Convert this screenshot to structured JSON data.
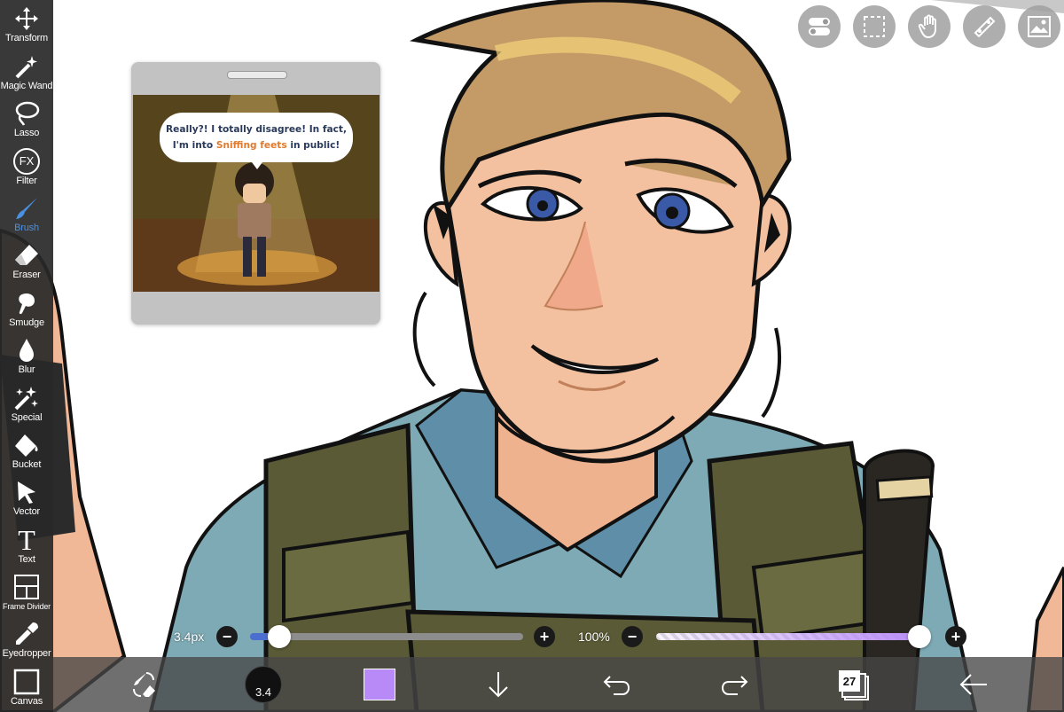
{
  "toolbar": {
    "items": [
      {
        "label": "Transform",
        "icon": "move-arrows-icon"
      },
      {
        "label": "Magic Wand",
        "icon": "magic-wand-icon"
      },
      {
        "label": "Lasso",
        "icon": "lasso-icon"
      },
      {
        "label": "Filter",
        "icon": "fx-icon"
      },
      {
        "label": "Brush",
        "icon": "brush-icon",
        "active": true
      },
      {
        "label": "Eraser",
        "icon": "eraser-icon"
      },
      {
        "label": "Smudge",
        "icon": "smudge-icon"
      },
      {
        "label": "Blur",
        "icon": "droplet-icon"
      },
      {
        "label": "Special",
        "icon": "sparkle-wand-icon"
      },
      {
        "label": "Bucket",
        "icon": "bucket-icon"
      },
      {
        "label": "Vector",
        "icon": "cursor-arrow-icon"
      },
      {
        "label": "Text",
        "icon": "text-t-icon"
      },
      {
        "label": "Frame Divider",
        "icon": "frame-divider-icon"
      },
      {
        "label": "Eyedropper",
        "icon": "eyedropper-icon"
      },
      {
        "label": "Canvas",
        "icon": "canvas-square-icon"
      }
    ]
  },
  "fx_glyph": "FX",
  "text_glyph": "T",
  "reference": {
    "line1": "Really?! I totally disagree! In fact,",
    "line2_before": "I'm into ",
    "line2_highlight": "Sniffing feets",
    "line2_after": " in public!"
  },
  "brush_size": {
    "value_text": "3.4px",
    "fraction": 0.07
  },
  "opacity": {
    "value_text": "100%",
    "fraction": 1.0
  },
  "minus_glyph": "−",
  "plus_glyph": "+",
  "bottom": {
    "brush_size_badge": "3.4",
    "color": "#b78af7",
    "layers_count": "27"
  },
  "colors": {
    "active_tool": "#4a90e2",
    "slider_fill": "#4a6fd1",
    "opacity_fill": "#b78af7"
  }
}
